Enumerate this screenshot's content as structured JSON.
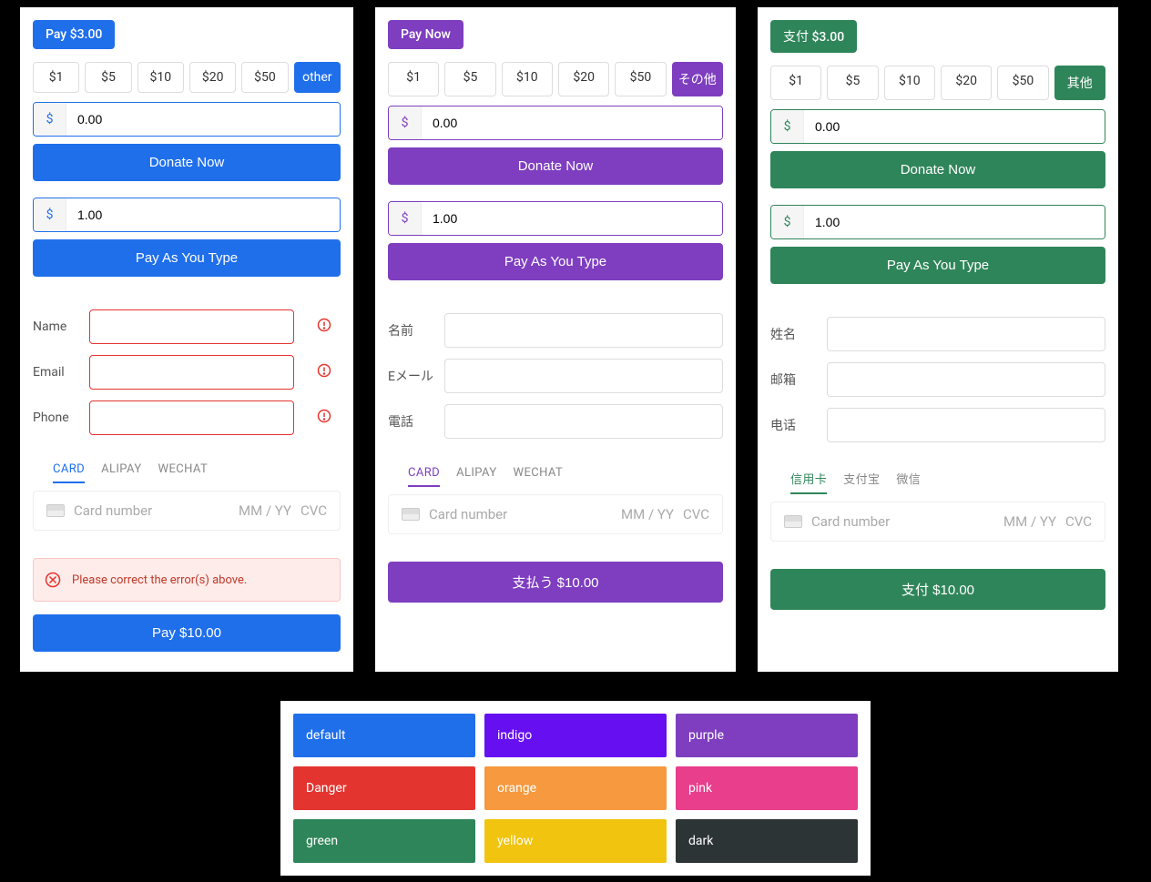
{
  "amounts": [
    "$1",
    "$5",
    "$10",
    "$20",
    "$50"
  ],
  "donate_label": "Donate Now",
  "payt_label": "Pay As You Type",
  "input_zero": "0.00",
  "input_one": "1.00",
  "card_placeholder": "Card number",
  "card_exp": "MM / YY",
  "card_cvc": "CVC",
  "tabs_en": {
    "card": "CARD",
    "alipay": "ALIPAY",
    "wechat": "WECHAT"
  },
  "columns": [
    {
      "accent": "#1f6feb",
      "top_btn": "Pay $3.00",
      "other": "other",
      "prefix": "$",
      "labels": {
        "name": "Name",
        "email": "Email",
        "phone": "Phone"
      },
      "tabs": {
        "card": "CARD",
        "alipay": "ALIPAY",
        "wechat": "WECHAT"
      },
      "error_msg": "Please correct the error(s) above.",
      "pay_final": "Pay $10.00",
      "show_errors": true
    },
    {
      "accent": "#7e3ebf",
      "top_btn": "Pay Now",
      "other": "その他",
      "prefix": "$",
      "labels": {
        "name": "名前",
        "email": "Eメール",
        "phone": "電話"
      },
      "tabs": {
        "card": "CARD",
        "alipay": "ALIPAY",
        "wechat": "WECHAT"
      },
      "pay_final": "支払う $10.00",
      "show_errors": false
    },
    {
      "accent": "#2f855a",
      "top_btn": "支付 $3.00",
      "other": "其他",
      "prefix": "$",
      "labels": {
        "name": "姓名",
        "email": "邮箱",
        "phone": "电话"
      },
      "tabs": {
        "card": "信用卡",
        "alipay": "支付宝",
        "wechat": "微信"
      },
      "pay_final": "支付 $10.00",
      "show_errors": false
    }
  ],
  "palette": [
    {
      "label": "default",
      "color": "#1f6feb"
    },
    {
      "label": "indigo",
      "color": "#6610f2"
    },
    {
      "label": "purple",
      "color": "#7e3ebf"
    },
    {
      "label": "Danger",
      "color": "#e3342f"
    },
    {
      "label": "orange",
      "color": "#f6993f"
    },
    {
      "label": "pink",
      "color": "#e83e8c"
    },
    {
      "label": "green",
      "color": "#2f855a"
    },
    {
      "label": "yellow",
      "color": "#f1c40f"
    },
    {
      "label": "dark",
      "color": "#2d3436"
    }
  ]
}
